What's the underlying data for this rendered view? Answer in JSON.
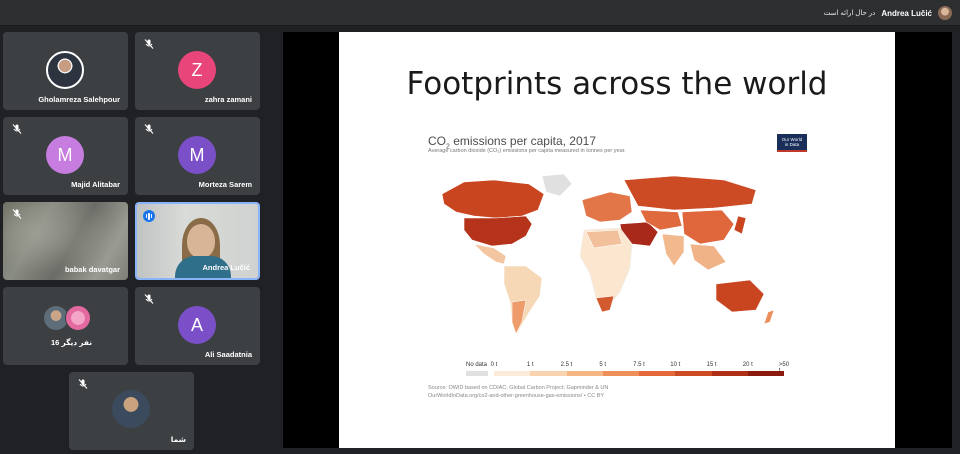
{
  "header": {
    "presenter_name": "Andrea Lučić",
    "presenter_status": "در حال ارائه است"
  },
  "participants": [
    {
      "name": "Gholamreza Salehpour",
      "type": "photo",
      "muted": false
    },
    {
      "name": "zahra zamani",
      "type": "letter",
      "letter": "Z",
      "color": "#e8457a",
      "muted": true
    },
    {
      "name": "Majid Alitabar",
      "type": "letter",
      "letter": "M",
      "color": "#c77de0",
      "muted": true
    },
    {
      "name": "Morteza Sarem",
      "type": "letter",
      "letter": "M",
      "color": "#7b4fc7",
      "muted": true
    },
    {
      "name": "babak davatgar",
      "type": "video-blurred",
      "muted": true
    },
    {
      "name": "Andrea Lučić",
      "type": "video",
      "speaking": true
    },
    {
      "name": "16 نفر دیگر",
      "type": "group"
    },
    {
      "name": "Ali Saadatnia",
      "type": "letter",
      "letter": "A",
      "color": "#7b4fc7",
      "muted": true
    },
    {
      "name": "شما",
      "type": "photo",
      "muted": true
    }
  ],
  "slide": {
    "title": "Footprints across the world",
    "chart_title_pre": "CO",
    "chart_title_sub": "2",
    "chart_title_post": " emissions per capita, 2017",
    "chart_subtitle": "Average carbon dioxide (CO₂) emissions per capita measured in tonnes per year.",
    "logo_line1": "Our World",
    "logo_line2": "in Data",
    "source_line1": "Source: OWID based on CDIAC; Global Carbon Project; Gapminder & UN",
    "source_line2": "OurWorldInData.org/co2-and-other-greenhouse-gas-emissions/ • CC BY",
    "legend": {
      "nodata_label": "No data",
      "ticks": [
        "0 t",
        "1 t",
        "2.5 t",
        "5 t",
        "7.5 t",
        "10 t",
        "15 t",
        "20 t",
        ">50 t"
      ],
      "colors": [
        "#fcebd8",
        "#f9d3b0",
        "#f5b584",
        "#ef905a",
        "#e3683a",
        "#cc4a24",
        "#ae2f17",
        "#8a1a0e"
      ]
    }
  }
}
